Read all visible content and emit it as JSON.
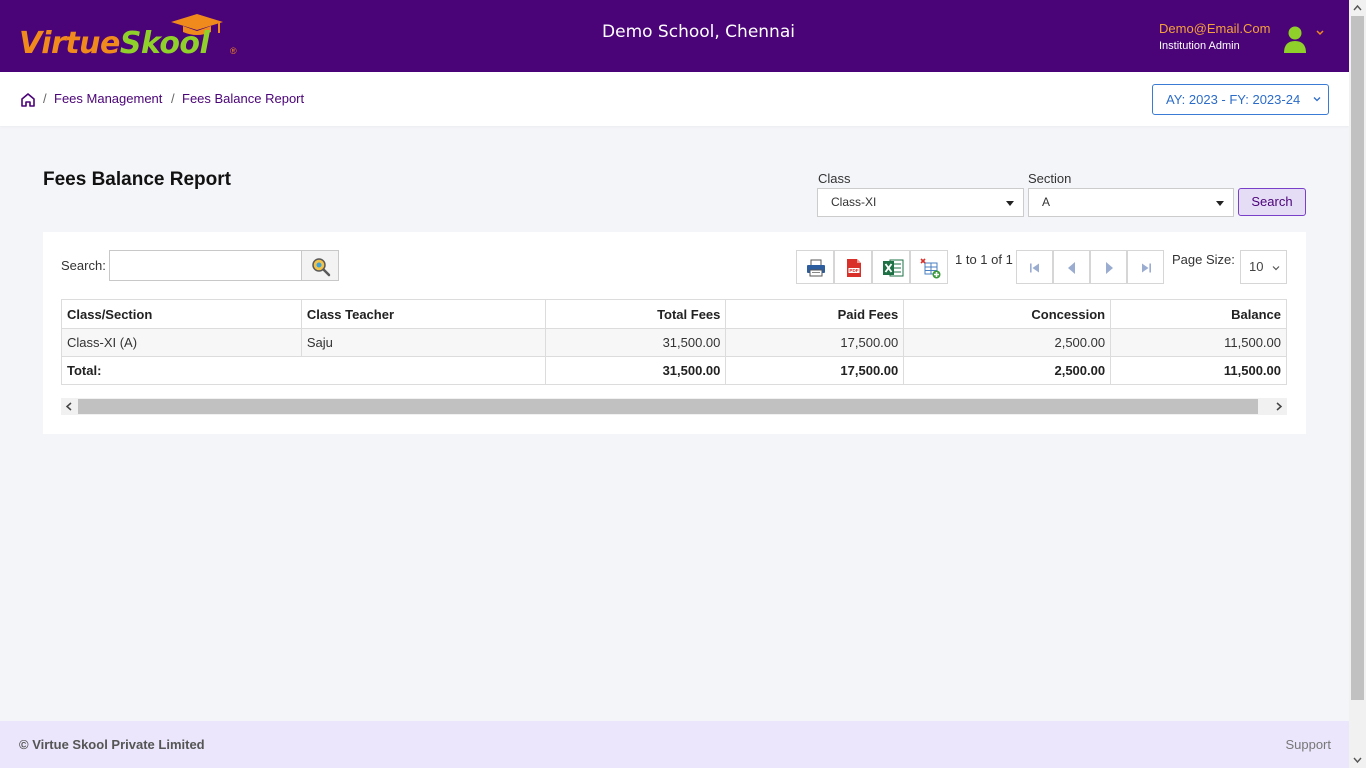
{
  "header": {
    "logo": {
      "part1": "Virtue",
      "part2": "Skool",
      "reg": "®"
    },
    "school_name": "Demo School, Chennai",
    "user": {
      "email": "Demo@Email.Com",
      "role": "Institution Admin"
    },
    "colors": {
      "bar": "#4b0378",
      "logo_orange": "#f08a1c",
      "logo_green": "#8fd12a"
    }
  },
  "breadcrumb": {
    "items": [
      "Fees Management",
      "Fees Balance Report"
    ],
    "separator": "/"
  },
  "academic_year": "AY: 2023 - FY: 2023-24",
  "page": {
    "title": "Fees Balance Report",
    "filters": {
      "class_label": "Class",
      "class_value": "Class-XI",
      "section_label": "Section",
      "section_value": "A",
      "search_label": "Search"
    }
  },
  "grid": {
    "search_label": "Search:",
    "search_value": "",
    "pager_text": "1 to 1 of 1",
    "page_size_label": "Page Size:",
    "page_size": "10",
    "columns": [
      "Class/Section",
      "Class Teacher",
      "Total Fees",
      "Paid Fees",
      "Concession",
      "Balance"
    ],
    "rows": [
      [
        "Class-XI (A)",
        "Saju",
        "31,500.00",
        "17,500.00",
        "2,500.00",
        "11,500.00"
      ]
    ],
    "total": {
      "label": "Total:",
      "total_fees": "31,500.00",
      "paid_fees": "17,500.00",
      "concession": "2,500.00",
      "balance": "11,500.00"
    }
  },
  "footer": {
    "copyright": "© Virtue Skool Private Limited",
    "support": "Support"
  }
}
